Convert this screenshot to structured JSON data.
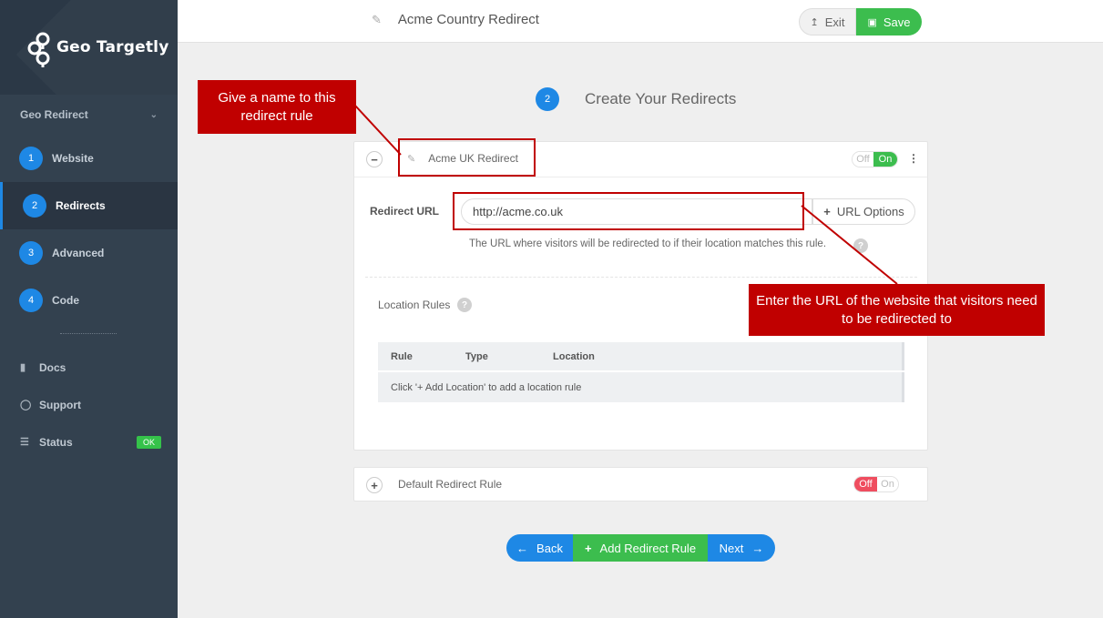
{
  "sidebar": {
    "brand": "Geo Targetly",
    "section": "Geo Redirect",
    "steps": [
      {
        "num": "1",
        "label": "Website"
      },
      {
        "num": "2",
        "label": "Redirects"
      },
      {
        "num": "3",
        "label": "Advanced"
      },
      {
        "num": "4",
        "label": "Code"
      }
    ],
    "links": [
      {
        "label": "Docs",
        "icon": "book-icon"
      },
      {
        "label": "Support",
        "icon": "chat-icon"
      },
      {
        "label": "Status",
        "icon": "database-icon",
        "badge": "OK"
      }
    ]
  },
  "topbar": {
    "title": "Acme Country Redirect",
    "exit_label": "Exit",
    "save_label": "Save"
  },
  "step_header": {
    "num": "2",
    "title": "Create Your Redirects"
  },
  "rule": {
    "name": "Acme UK Redirect",
    "toggle_off": "Off",
    "toggle_on": "On",
    "url_label": "Redirect URL",
    "url_value": "http://acme.co.uk",
    "url_options_label": "URL Options",
    "hint": "The URL where visitors will be redirected to if their location matches this rule.",
    "location_rules_title": "Location Rules",
    "columns": [
      "Rule",
      "Type",
      "Location"
    ],
    "empty_message": "Click '+ Add Location' to add a location rule"
  },
  "default_rule": {
    "label": "Default Redirect Rule",
    "toggle_off": "Off",
    "toggle_on": "On"
  },
  "bottom": {
    "back_label": "Back",
    "add_label": "Add Redirect Rule",
    "next_label": "Next"
  },
  "annotations": {
    "name_callout": "Give a name to this redirect rule",
    "url_callout": "Enter the URL of the website that visitors need to be redirected to"
  },
  "colors": {
    "sidebar": "#33414f",
    "accent_blue": "#1e88e5",
    "accent_green": "#3cbd4e",
    "off_red": "#ef4d5f",
    "callout_red": "#c00000"
  }
}
